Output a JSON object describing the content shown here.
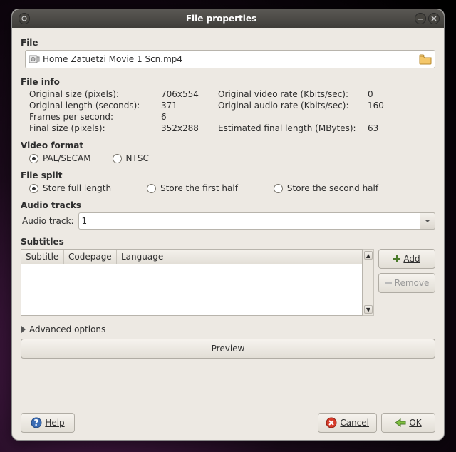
{
  "window": {
    "title": "File properties"
  },
  "file": {
    "section": "File",
    "path": "Home Zatuetzi Movie 1 Scn.mp4"
  },
  "file_info": {
    "section": "File info",
    "rows": [
      {
        "l1": "Original size (pixels):",
        "v1": "706x554",
        "l2": "Original video rate (Kbits/sec):",
        "v2": "0"
      },
      {
        "l1": "Original length (seconds):",
        "v1": "371",
        "l2": "Original audio rate (Kbits/sec):",
        "v2": "160"
      },
      {
        "l1": "Frames per second:",
        "v1": "6",
        "l2": "",
        "v2": ""
      },
      {
        "l1": "Final size (pixels):",
        "v1": "352x288",
        "l2": "Estimated final length (MBytes):",
        "v2": "63"
      }
    ]
  },
  "video_format": {
    "section": "Video format",
    "options": {
      "pal": "PAL/SECAM",
      "ntsc": "NTSC"
    },
    "selected": "pal"
  },
  "file_split": {
    "section": "File split",
    "options": {
      "full": "Store full length",
      "first": "Store the first half",
      "second": "Store the second half"
    },
    "selected": "full"
  },
  "audio": {
    "section": "Audio tracks",
    "label": "Audio track:",
    "value": "1"
  },
  "subtitles": {
    "section": "Subtitles",
    "columns": {
      "c1": "Subtitle",
      "c2": "Codepage",
      "c3": "Language"
    },
    "add": "Add",
    "remove": "Remove"
  },
  "advanced": "Advanced options",
  "preview": "Preview",
  "footer": {
    "help": "Help",
    "cancel": "Cancel",
    "ok": "OK"
  }
}
